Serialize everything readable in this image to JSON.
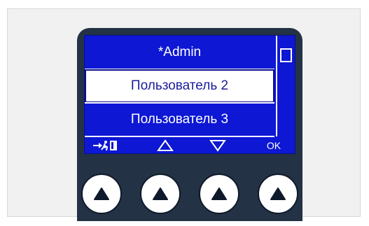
{
  "display": {
    "menu_items": [
      {
        "label": "*Admin",
        "selected": false
      },
      {
        "label": "Пользователь 2",
        "selected": true
      },
      {
        "label": "Пользователь 3",
        "selected": false
      }
    ],
    "softkeys": {
      "exit_icon": "exit-door-icon",
      "up_icon": "triangle-up-outline-icon",
      "down_icon": "triangle-down-outline-icon",
      "ok_label": "OK"
    }
  },
  "hardware_buttons": [
    {
      "icon": "triangle-up-filled-icon"
    },
    {
      "icon": "triangle-up-filled-icon"
    },
    {
      "icon": "triangle-up-filled-icon"
    },
    {
      "icon": "triangle-up-filled-icon"
    }
  ],
  "colors": {
    "screen_blue": "#0d17d4",
    "device_body": "#233244",
    "selected_bg": "#ffffff",
    "selected_text": "#1c1c9c"
  }
}
